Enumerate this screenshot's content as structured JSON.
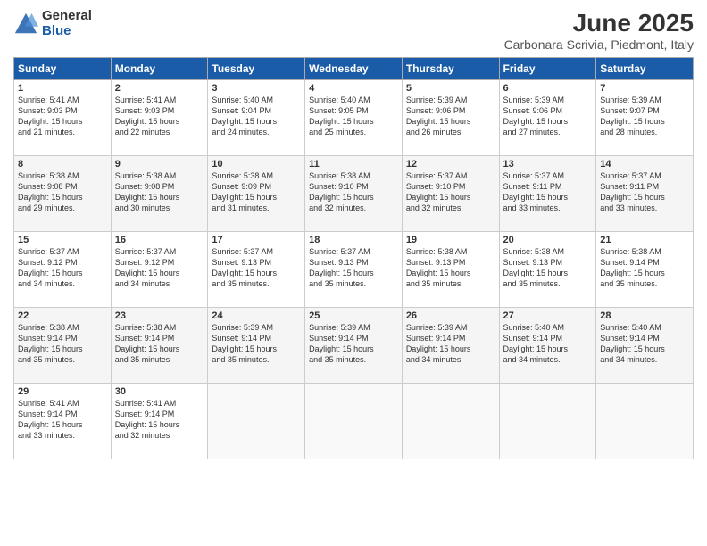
{
  "header": {
    "logo_general": "General",
    "logo_blue": "Blue",
    "title": "June 2025",
    "subtitle": "Carbonara Scrivia, Piedmont, Italy"
  },
  "calendar": {
    "headers": [
      "Sunday",
      "Monday",
      "Tuesday",
      "Wednesday",
      "Thursday",
      "Friday",
      "Saturday"
    ],
    "weeks": [
      [
        {
          "day": "",
          "info": ""
        },
        {
          "day": "2",
          "info": "Sunrise: 5:41 AM\nSunset: 9:03 PM\nDaylight: 15 hours\nand 22 minutes."
        },
        {
          "day": "3",
          "info": "Sunrise: 5:40 AM\nSunset: 9:04 PM\nDaylight: 15 hours\nand 24 minutes."
        },
        {
          "day": "4",
          "info": "Sunrise: 5:40 AM\nSunset: 9:05 PM\nDaylight: 15 hours\nand 25 minutes."
        },
        {
          "day": "5",
          "info": "Sunrise: 5:39 AM\nSunset: 9:06 PM\nDaylight: 15 hours\nand 26 minutes."
        },
        {
          "day": "6",
          "info": "Sunrise: 5:39 AM\nSunset: 9:06 PM\nDaylight: 15 hours\nand 27 minutes."
        },
        {
          "day": "7",
          "info": "Sunrise: 5:39 AM\nSunset: 9:07 PM\nDaylight: 15 hours\nand 28 minutes."
        }
      ],
      [
        {
          "day": "1",
          "info": "Sunrise: 5:41 AM\nSunset: 9:03 PM\nDaylight: 15 hours\nand 21 minutes."
        },
        {
          "day": "9",
          "info": "Sunrise: 5:38 AM\nSunset: 9:08 PM\nDaylight: 15 hours\nand 30 minutes."
        },
        {
          "day": "10",
          "info": "Sunrise: 5:38 AM\nSunset: 9:09 PM\nDaylight: 15 hours\nand 31 minutes."
        },
        {
          "day": "11",
          "info": "Sunrise: 5:38 AM\nSunset: 9:10 PM\nDaylight: 15 hours\nand 32 minutes."
        },
        {
          "day": "12",
          "info": "Sunrise: 5:37 AM\nSunset: 9:10 PM\nDaylight: 15 hours\nand 32 minutes."
        },
        {
          "day": "13",
          "info": "Sunrise: 5:37 AM\nSunset: 9:11 PM\nDaylight: 15 hours\nand 33 minutes."
        },
        {
          "day": "14",
          "info": "Sunrise: 5:37 AM\nSunset: 9:11 PM\nDaylight: 15 hours\nand 33 minutes."
        }
      ],
      [
        {
          "day": "8",
          "info": "Sunrise: 5:38 AM\nSunset: 9:08 PM\nDaylight: 15 hours\nand 29 minutes."
        },
        {
          "day": "16",
          "info": "Sunrise: 5:37 AM\nSunset: 9:12 PM\nDaylight: 15 hours\nand 34 minutes."
        },
        {
          "day": "17",
          "info": "Sunrise: 5:37 AM\nSunset: 9:13 PM\nDaylight: 15 hours\nand 35 minutes."
        },
        {
          "day": "18",
          "info": "Sunrise: 5:37 AM\nSunset: 9:13 PM\nDaylight: 15 hours\nand 35 minutes."
        },
        {
          "day": "19",
          "info": "Sunrise: 5:38 AM\nSunset: 9:13 PM\nDaylight: 15 hours\nand 35 minutes."
        },
        {
          "day": "20",
          "info": "Sunrise: 5:38 AM\nSunset: 9:13 PM\nDaylight: 15 hours\nand 35 minutes."
        },
        {
          "day": "21",
          "info": "Sunrise: 5:38 AM\nSunset: 9:14 PM\nDaylight: 15 hours\nand 35 minutes."
        }
      ],
      [
        {
          "day": "15",
          "info": "Sunrise: 5:37 AM\nSunset: 9:12 PM\nDaylight: 15 hours\nand 34 minutes."
        },
        {
          "day": "23",
          "info": "Sunrise: 5:38 AM\nSunset: 9:14 PM\nDaylight: 15 hours\nand 35 minutes."
        },
        {
          "day": "24",
          "info": "Sunrise: 5:39 AM\nSunset: 9:14 PM\nDaylight: 15 hours\nand 35 minutes."
        },
        {
          "day": "25",
          "info": "Sunrise: 5:39 AM\nSunset: 9:14 PM\nDaylight: 15 hours\nand 35 minutes."
        },
        {
          "day": "26",
          "info": "Sunrise: 5:39 AM\nSunset: 9:14 PM\nDaylight: 15 hours\nand 34 minutes."
        },
        {
          "day": "27",
          "info": "Sunrise: 5:40 AM\nSunset: 9:14 PM\nDaylight: 15 hours\nand 34 minutes."
        },
        {
          "day": "28",
          "info": "Sunrise: 5:40 AM\nSunset: 9:14 PM\nDaylight: 15 hours\nand 34 minutes."
        }
      ],
      [
        {
          "day": "22",
          "info": "Sunrise: 5:38 AM\nSunset: 9:14 PM\nDaylight: 15 hours\nand 35 minutes."
        },
        {
          "day": "30",
          "info": "Sunrise: 5:41 AM\nSunset: 9:14 PM\nDaylight: 15 hours\nand 32 minutes."
        },
        {
          "day": "",
          "info": ""
        },
        {
          "day": "",
          "info": ""
        },
        {
          "day": "",
          "info": ""
        },
        {
          "day": "",
          "info": ""
        },
        {
          "day": ""
        }
      ],
      [
        {
          "day": "29",
          "info": "Sunrise: 5:41 AM\nSunset: 9:14 PM\nDaylight: 15 hours\nand 33 minutes."
        },
        {
          "day": "",
          "info": ""
        },
        {
          "day": "",
          "info": ""
        },
        {
          "day": "",
          "info": ""
        },
        {
          "day": "",
          "info": ""
        },
        {
          "day": "",
          "info": ""
        },
        {
          "day": "",
          "info": ""
        }
      ]
    ]
  }
}
